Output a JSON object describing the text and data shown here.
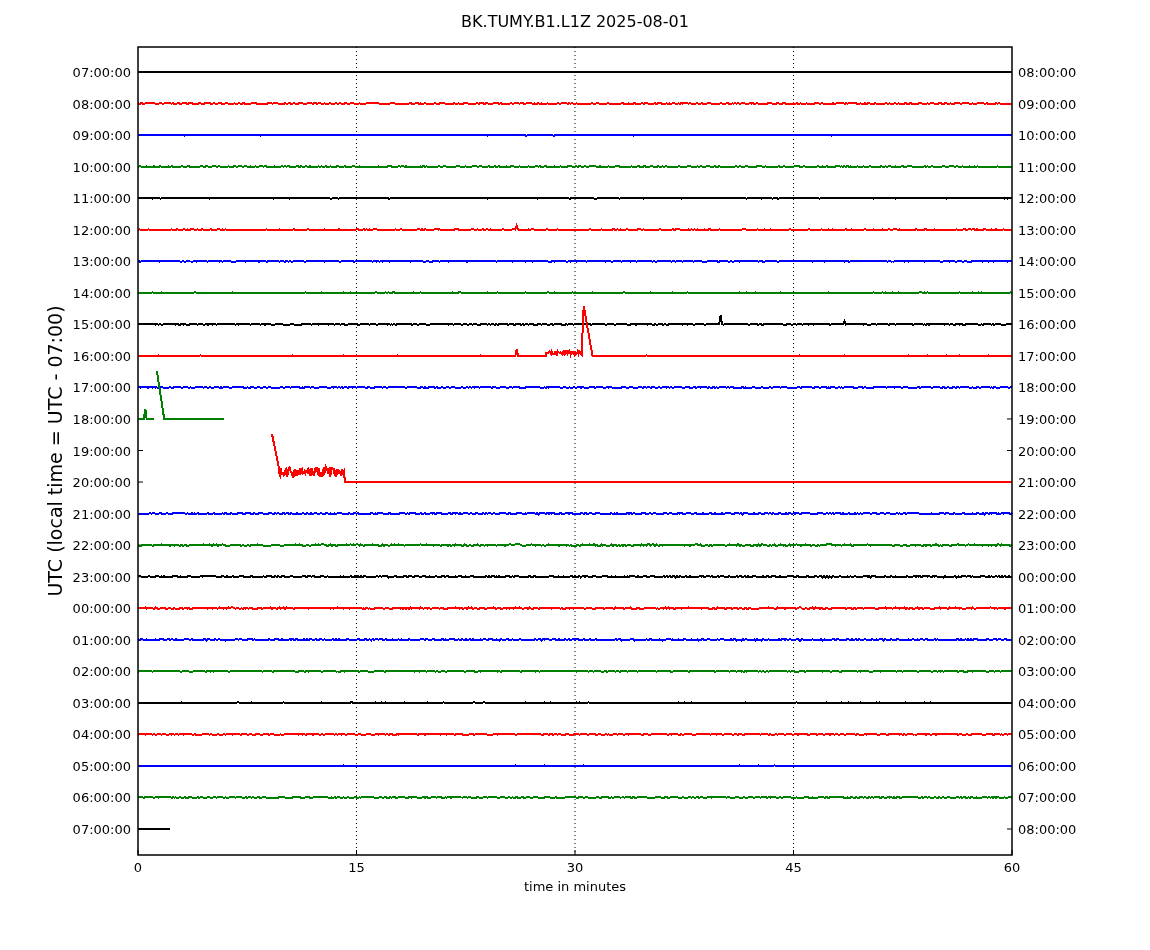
{
  "plot": {
    "title": "BK.TUMY.B1.L1Z 2025-08-01",
    "ylabel": "UTC (local time = UTC - 07:00)",
    "xlabel": "time in minutes",
    "xticks": [
      "0",
      "15",
      "30",
      "45",
      "60"
    ],
    "rows": [
      {
        "left": "07:00:00",
        "right": "08:00:00",
        "color": "#000000"
      },
      {
        "left": "08:00:00",
        "right": "09:00:00",
        "color": "#ff0000"
      },
      {
        "left": "09:00:00",
        "right": "10:00:00",
        "color": "#0000ff"
      },
      {
        "left": "10:00:00",
        "right": "11:00:00",
        "color": "#008000"
      },
      {
        "left": "11:00:00",
        "right": "12:00:00",
        "color": "#000000"
      },
      {
        "left": "12:00:00",
        "right": "13:00:00",
        "color": "#ff0000"
      },
      {
        "left": "13:00:00",
        "right": "14:00:00",
        "color": "#0000ff"
      },
      {
        "left": "14:00:00",
        "right": "15:00:00",
        "color": "#008000"
      },
      {
        "left": "15:00:00",
        "right": "16:00:00",
        "color": "#000000"
      },
      {
        "left": "16:00:00",
        "right": "17:00:00",
        "color": "#ff0000"
      },
      {
        "left": "17:00:00",
        "right": "18:00:00",
        "color": "#0000ff"
      },
      {
        "left": "18:00:00",
        "right": "19:00:00",
        "color": "#008000"
      },
      {
        "left": "19:00:00",
        "right": "20:00:00"
      },
      {
        "left": "20:00:00",
        "right": "21:00:00",
        "color": "#ff0000"
      },
      {
        "left": "21:00:00",
        "right": "22:00:00",
        "color": "#0000ff"
      },
      {
        "left": "22:00:00",
        "right": "23:00:00",
        "color": "#008000"
      },
      {
        "left": "23:00:00",
        "right": "00:00:00",
        "color": "#000000"
      },
      {
        "left": "00:00:00",
        "right": "01:00:00",
        "color": "#ff0000"
      },
      {
        "left": "01:00:00",
        "right": "02:00:00",
        "color": "#0000ff"
      },
      {
        "left": "02:00:00",
        "right": "03:00:00",
        "color": "#008000"
      },
      {
        "left": "03:00:00",
        "right": "04:00:00",
        "color": "#000000"
      },
      {
        "left": "04:00:00",
        "right": "05:00:00",
        "color": "#ff0000"
      },
      {
        "left": "05:00:00",
        "right": "06:00:00",
        "color": "#0000ff"
      },
      {
        "left": "06:00:00",
        "right": "07:00:00",
        "color": "#008000"
      },
      {
        "left": "07:00:00",
        "right": "08:00:00",
        "color": "#000000"
      }
    ]
  }
}
